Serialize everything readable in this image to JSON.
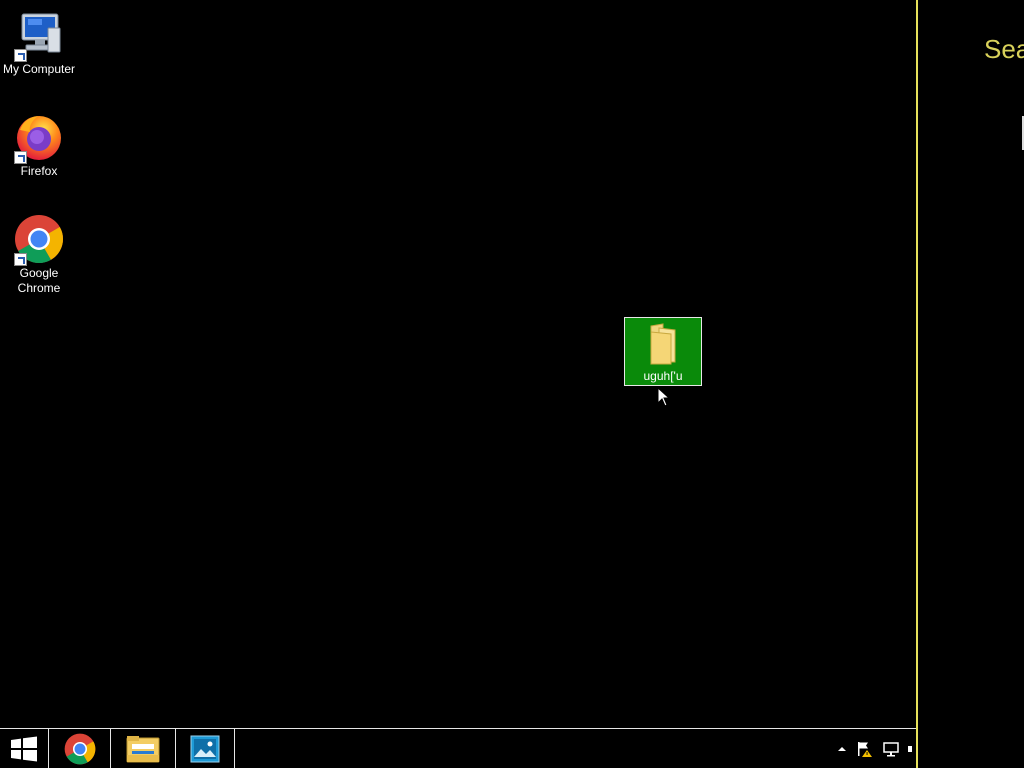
{
  "desktop": {
    "icons": [
      {
        "label": "My Computer",
        "icon": "my-computer-icon"
      },
      {
        "label": "Firefox",
        "icon": "firefox-icon"
      },
      {
        "label": "Google Chrome",
        "icon": "google-chrome-icon"
      }
    ],
    "selected_folder": {
      "label": "uguh['u",
      "icon": "folder-icon"
    }
  },
  "charm": {
    "title": "Sea"
  },
  "taskbar": {
    "buttons": [
      {
        "icon": "windows-start-icon"
      },
      {
        "icon": "chrome-icon"
      },
      {
        "icon": "file-explorer-icon"
      },
      {
        "icon": "image-viewer-icon"
      }
    ],
    "tray": [
      "show-hidden-icons",
      "action-center-flag-icon",
      "network-icon",
      "volume-icon"
    ]
  },
  "colors": {
    "selection": "#0a8a0a",
    "charm_accent": "#e6e15a",
    "charm_text": "#d8d15a"
  }
}
